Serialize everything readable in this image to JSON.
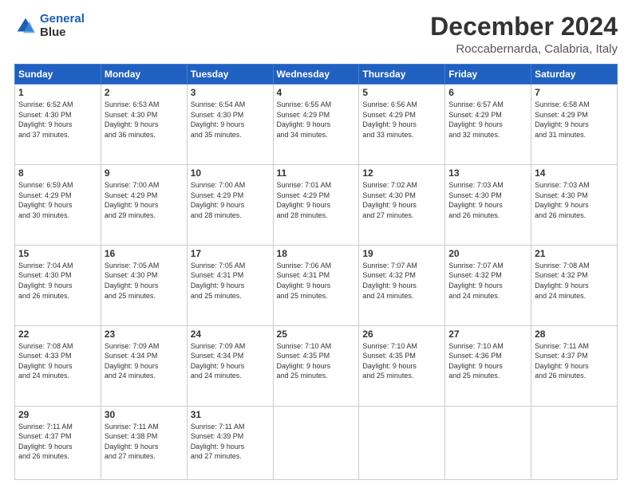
{
  "logo": {
    "line1": "General",
    "line2": "Blue"
  },
  "title": "December 2024",
  "subtitle": "Roccabernarda, Calabria, Italy",
  "days_header": [
    "Sunday",
    "Monday",
    "Tuesday",
    "Wednesday",
    "Thursday",
    "Friday",
    "Saturday"
  ],
  "weeks": [
    [
      {
        "num": "1",
        "info": "Sunrise: 6:52 AM\nSunset: 4:30 PM\nDaylight: 9 hours\nand 37 minutes."
      },
      {
        "num": "2",
        "info": "Sunrise: 6:53 AM\nSunset: 4:30 PM\nDaylight: 9 hours\nand 36 minutes."
      },
      {
        "num": "3",
        "info": "Sunrise: 6:54 AM\nSunset: 4:30 PM\nDaylight: 9 hours\nand 35 minutes."
      },
      {
        "num": "4",
        "info": "Sunrise: 6:55 AM\nSunset: 4:29 PM\nDaylight: 9 hours\nand 34 minutes."
      },
      {
        "num": "5",
        "info": "Sunrise: 6:56 AM\nSunset: 4:29 PM\nDaylight: 9 hours\nand 33 minutes."
      },
      {
        "num": "6",
        "info": "Sunrise: 6:57 AM\nSunset: 4:29 PM\nDaylight: 9 hours\nand 32 minutes."
      },
      {
        "num": "7",
        "info": "Sunrise: 6:58 AM\nSunset: 4:29 PM\nDaylight: 9 hours\nand 31 minutes."
      }
    ],
    [
      {
        "num": "8",
        "info": "Sunrise: 6:59 AM\nSunset: 4:29 PM\nDaylight: 9 hours\nand 30 minutes."
      },
      {
        "num": "9",
        "info": "Sunrise: 7:00 AM\nSunset: 4:29 PM\nDaylight: 9 hours\nand 29 minutes."
      },
      {
        "num": "10",
        "info": "Sunrise: 7:00 AM\nSunset: 4:29 PM\nDaylight: 9 hours\nand 28 minutes."
      },
      {
        "num": "11",
        "info": "Sunrise: 7:01 AM\nSunset: 4:29 PM\nDaylight: 9 hours\nand 28 minutes."
      },
      {
        "num": "12",
        "info": "Sunrise: 7:02 AM\nSunset: 4:30 PM\nDaylight: 9 hours\nand 27 minutes."
      },
      {
        "num": "13",
        "info": "Sunrise: 7:03 AM\nSunset: 4:30 PM\nDaylight: 9 hours\nand 26 minutes."
      },
      {
        "num": "14",
        "info": "Sunrise: 7:03 AM\nSunset: 4:30 PM\nDaylight: 9 hours\nand 26 minutes."
      }
    ],
    [
      {
        "num": "15",
        "info": "Sunrise: 7:04 AM\nSunset: 4:30 PM\nDaylight: 9 hours\nand 26 minutes."
      },
      {
        "num": "16",
        "info": "Sunrise: 7:05 AM\nSunset: 4:30 PM\nDaylight: 9 hours\nand 25 minutes."
      },
      {
        "num": "17",
        "info": "Sunrise: 7:05 AM\nSunset: 4:31 PM\nDaylight: 9 hours\nand 25 minutes."
      },
      {
        "num": "18",
        "info": "Sunrise: 7:06 AM\nSunset: 4:31 PM\nDaylight: 9 hours\nand 25 minutes."
      },
      {
        "num": "19",
        "info": "Sunrise: 7:07 AM\nSunset: 4:32 PM\nDaylight: 9 hours\nand 24 minutes."
      },
      {
        "num": "20",
        "info": "Sunrise: 7:07 AM\nSunset: 4:32 PM\nDaylight: 9 hours\nand 24 minutes."
      },
      {
        "num": "21",
        "info": "Sunrise: 7:08 AM\nSunset: 4:32 PM\nDaylight: 9 hours\nand 24 minutes."
      }
    ],
    [
      {
        "num": "22",
        "info": "Sunrise: 7:08 AM\nSunset: 4:33 PM\nDaylight: 9 hours\nand 24 minutes."
      },
      {
        "num": "23",
        "info": "Sunrise: 7:09 AM\nSunset: 4:34 PM\nDaylight: 9 hours\nand 24 minutes."
      },
      {
        "num": "24",
        "info": "Sunrise: 7:09 AM\nSunset: 4:34 PM\nDaylight: 9 hours\nand 24 minutes."
      },
      {
        "num": "25",
        "info": "Sunrise: 7:10 AM\nSunset: 4:35 PM\nDaylight: 9 hours\nand 25 minutes."
      },
      {
        "num": "26",
        "info": "Sunrise: 7:10 AM\nSunset: 4:35 PM\nDaylight: 9 hours\nand 25 minutes."
      },
      {
        "num": "27",
        "info": "Sunrise: 7:10 AM\nSunset: 4:36 PM\nDaylight: 9 hours\nand 25 minutes."
      },
      {
        "num": "28",
        "info": "Sunrise: 7:11 AM\nSunset: 4:37 PM\nDaylight: 9 hours\nand 26 minutes."
      }
    ],
    [
      {
        "num": "29",
        "info": "Sunrise: 7:11 AM\nSunset: 4:37 PM\nDaylight: 9 hours\nand 26 minutes."
      },
      {
        "num": "30",
        "info": "Sunrise: 7:11 AM\nSunset: 4:38 PM\nDaylight: 9 hours\nand 27 minutes."
      },
      {
        "num": "31",
        "info": "Sunrise: 7:11 AM\nSunset: 4:39 PM\nDaylight: 9 hours\nand 27 minutes."
      },
      {
        "num": "",
        "info": ""
      },
      {
        "num": "",
        "info": ""
      },
      {
        "num": "",
        "info": ""
      },
      {
        "num": "",
        "info": ""
      }
    ]
  ]
}
